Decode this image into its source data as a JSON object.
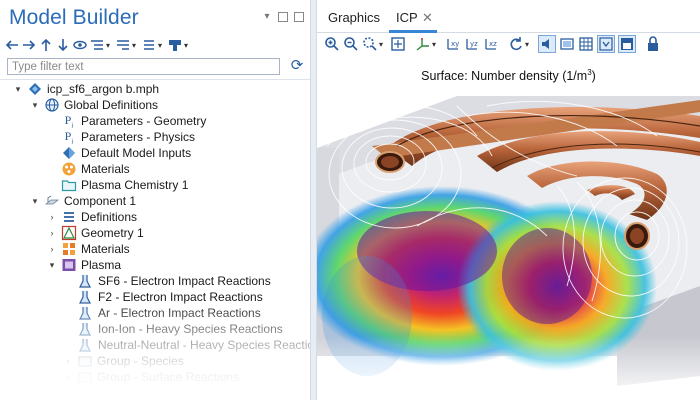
{
  "left_panel": {
    "title": "Model Builder",
    "filter_placeholder": "Type filter text",
    "toolbar_icons": [
      "arrow-left-icon",
      "arrow-right-icon",
      "arrow-up-icon",
      "arrow-down-icon",
      "show-icon",
      "expand-sections-icon",
      "collapse-icon",
      "model-tree-columns-icon",
      "build-icon"
    ]
  },
  "tree": {
    "root": "icp_sf6_argon b.mph",
    "global_definitions": "Global Definitions",
    "param_geometry": "Parameters - Geometry",
    "param_physics": "Parameters - Physics",
    "default_model_inputs": "Default Model Inputs",
    "materials_global": "Materials",
    "plasma_chemistry": "Plasma Chemistry 1",
    "component": "Component 1",
    "definitions": "Definitions",
    "geometry": "Geometry 1",
    "materials": "Materials",
    "plasma": "Plasma",
    "sf6": "SF6 - Electron Impact Reactions",
    "f2": "F2 - Electron Impact Reactions",
    "ar": "Ar - Electron Impact Reactions",
    "ion_ion": "Ion-Ion - Heavy Species Reactions",
    "neutral": "Neutral-Neutral - Heavy Species Reactions",
    "group_species": "Group - Species",
    "group_surface": "Group - Surface Reactions"
  },
  "right_panel": {
    "tabs": [
      "Graphics",
      "ICP"
    ],
    "active_tab": "ICP",
    "close_glyph": "✕",
    "plot_title_prefix": "Surface: Number density (1/m",
    "plot_title_sup": "3",
    "plot_title_suffix": ")"
  },
  "colors": {
    "accent_blue": "#2b6cb8",
    "tab_underline": "#3a86d6",
    "coil_copper": "#b86a3a"
  }
}
